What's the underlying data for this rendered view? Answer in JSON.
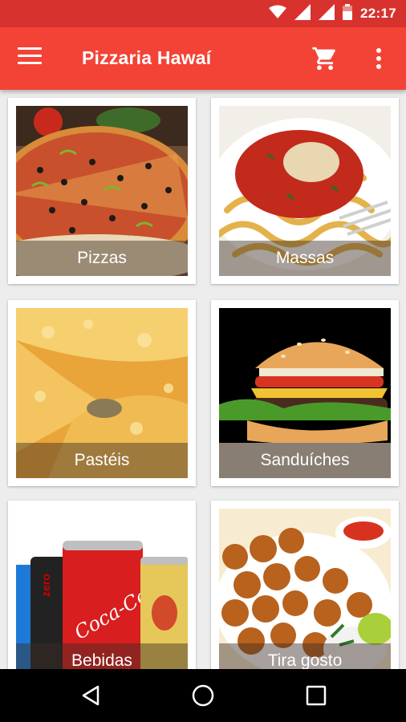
{
  "status_bar": {
    "time": "22:17",
    "icons": [
      "wifi-icon",
      "signal-icon",
      "signal-icon",
      "battery-icon"
    ]
  },
  "app_bar": {
    "title": "Pizzaria Hawaí",
    "menu_icon": "hamburger-menu-icon",
    "cart_icon": "shopping-cart-icon",
    "more_icon": "more-vertical-icon"
  },
  "categories": [
    {
      "label": "Pizzas"
    },
    {
      "label": "Massas"
    },
    {
      "label": "Pastéis"
    },
    {
      "label": "Sanduíches"
    },
    {
      "label": "Bebidas"
    },
    {
      "label": "Tira gosto"
    }
  ],
  "nav_bar": {
    "icons": [
      "back-icon",
      "home-icon",
      "recents-icon"
    ]
  },
  "colors": {
    "status_bar": "#d8322f",
    "app_bar": "#f34336",
    "background": "#ededed"
  }
}
